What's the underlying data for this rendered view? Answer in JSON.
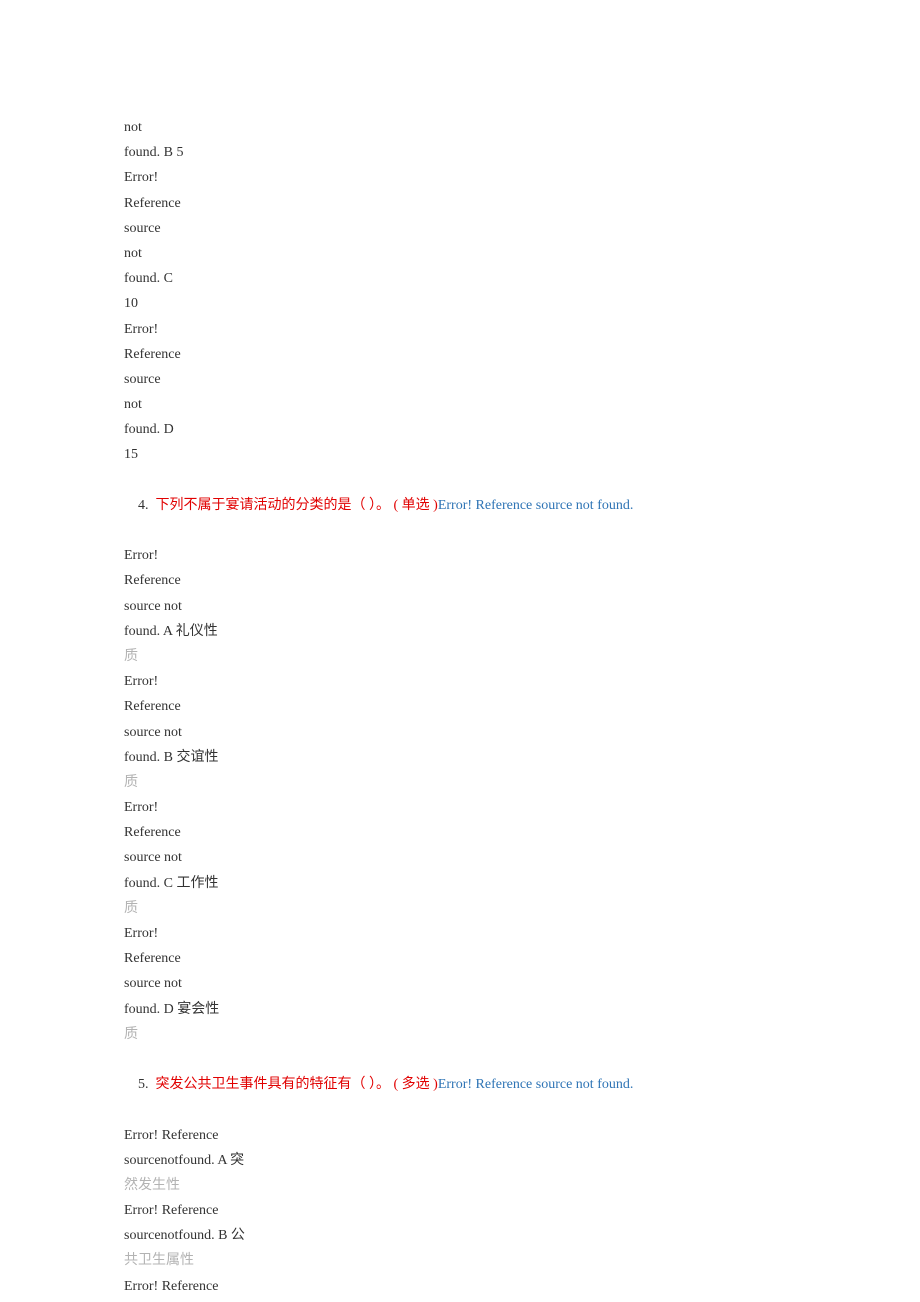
{
  "block1": {
    "l1": "not",
    "l2": "found. B 5",
    "l3": "Error!",
    "l4": "Reference",
    "l5": "source",
    "l6": "not",
    "l7": "found. C",
    "l8": "10",
    "l9": "Error!",
    "l10": "Reference",
    "l11": "source",
    "l12": "not",
    "l13": "found. D",
    "l14": "15"
  },
  "q4": {
    "num": "4.  ",
    "red": "下列不属于宴请活动的分类的是（ ）。 ( 单选 )",
    "blue": "Error! Reference source not found."
  },
  "block2": {
    "l1": "Error!",
    "l2": "Reference",
    "l3": "source not",
    "l4": "found. A 礼仪性",
    "l5": "质",
    "l6": "Error!",
    "l7": "Reference",
    "l8": "source not",
    "l9": "found. B 交谊性",
    "l10": "质",
    "l11": "Error!",
    "l12": "Reference",
    "l13": "source not",
    "l14": "found. C 工作性",
    "l15": "质",
    "l16": "Error!",
    "l17": "Reference",
    "l18": "source not",
    "l19": "found. D 宴会性",
    "l20": "质"
  },
  "q5": {
    "num": "5.  ",
    "red": "突发公共卫生事件具有的特征有（ ）。 ( 多选 )",
    "blue": "Error! Reference source not found."
  },
  "block3": {
    "l1": "Error! Reference",
    "l2": "sourcenotfound. A 突",
    "l3": "然发生性",
    "l4": "Error! Reference",
    "l5": "sourcenotfound. B 公",
    "l6": "共卫生属性",
    "l7": "Error! Reference"
  }
}
